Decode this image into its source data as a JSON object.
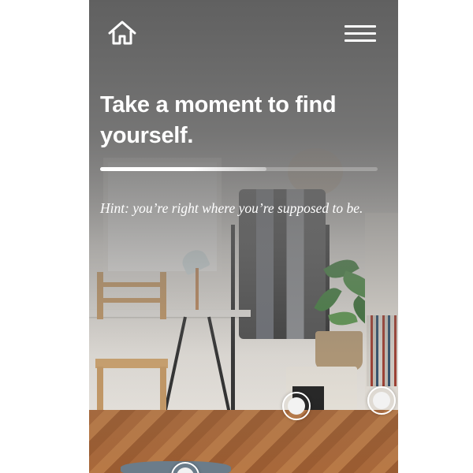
{
  "header": {
    "home_icon": "home-icon",
    "menu_icon": "hamburger-menu-icon"
  },
  "main": {
    "title": "Take a moment to find yourself.",
    "progress_percent": 60,
    "hint": "Hint: you’re right where you’re supposed to be."
  },
  "hotspots": [
    {
      "name": "hotspot-cabinet"
    },
    {
      "name": "hotspot-bookshelf"
    },
    {
      "name": "hotspot-rug"
    }
  ],
  "colors": {
    "text": "#ffffff",
    "overlay": "#5f5f5f"
  }
}
